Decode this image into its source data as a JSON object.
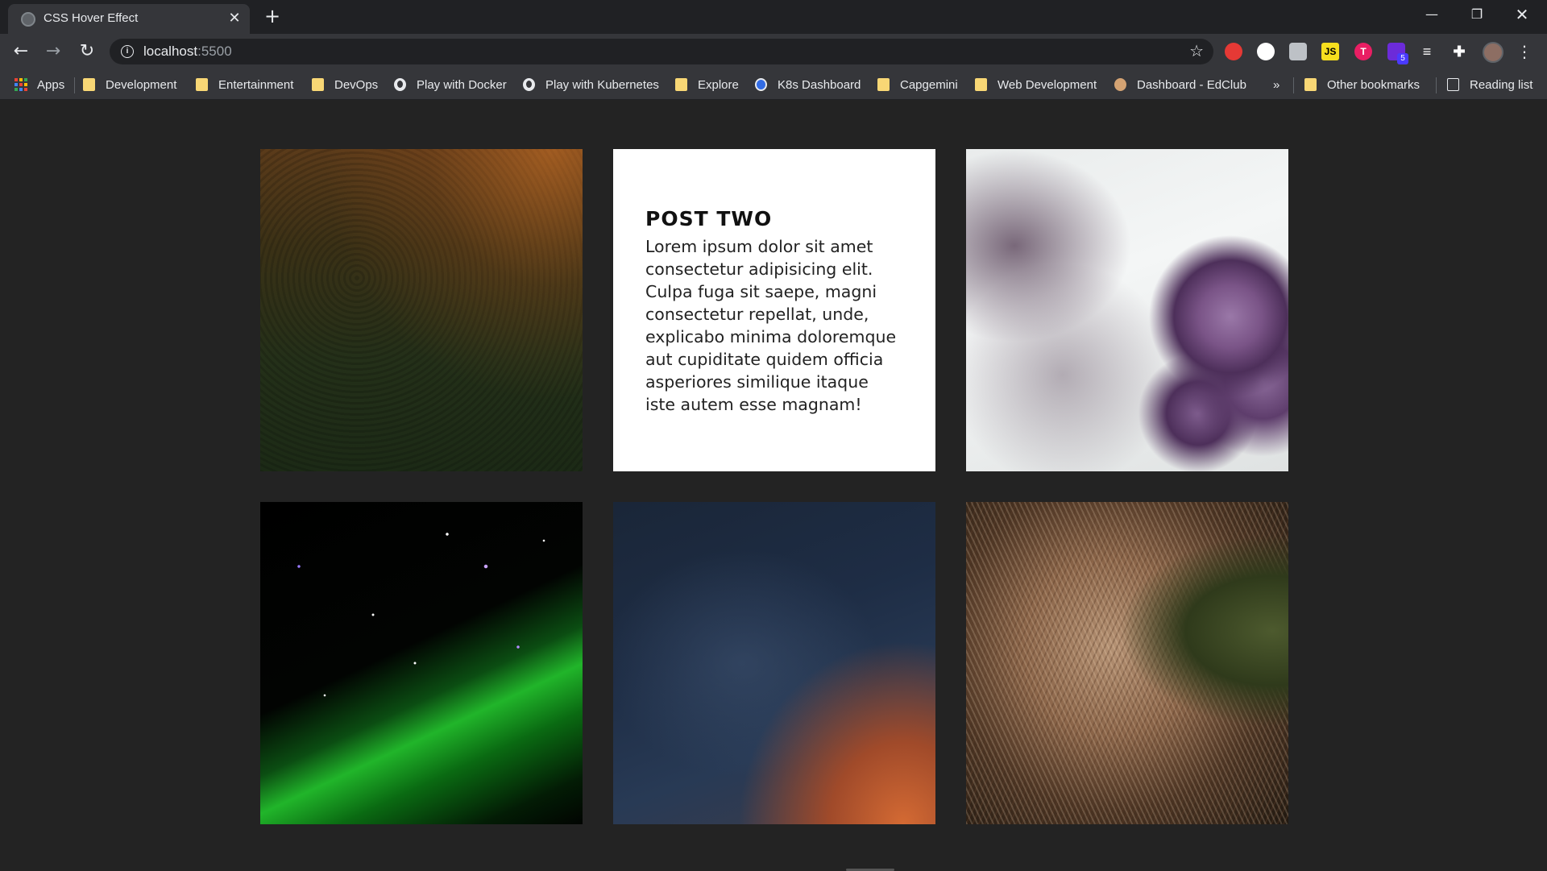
{
  "browser": {
    "tab_title": "CSS Hover Effect",
    "tab_close": "✕",
    "new_tab": "+",
    "window_controls": {
      "minimize": "—",
      "maximize": "❐",
      "close": "✕"
    },
    "nav": {
      "back": "←",
      "forward": "→",
      "reload": "↻"
    },
    "url_host": "localhost",
    "url_port": ":5500",
    "info_icon": "i",
    "star": "☆",
    "extensions": [
      "",
      "",
      "",
      "JS",
      "T",
      "",
      "≡",
      "✚"
    ],
    "extension_badge": "5",
    "menu": "⋮"
  },
  "bookmarks": {
    "apps": "Apps",
    "items": [
      "Development",
      "Entertainment",
      "DevOps",
      "Play with Docker",
      "Play with Kubernetes",
      "Explore",
      "K8s Dashboard",
      "Capgemini",
      "Web Development",
      "Dashboard - EdClub"
    ],
    "overflow": "»",
    "other": "Other bookmarks",
    "reading_list": "Reading list"
  },
  "posts": {
    "card2": {
      "title": "POST TWO",
      "body": "Lorem ipsum dolor sit amet consectetur adipisicing elit. Culpa fuga sit saepe, magni consectetur repellat, unde, explicabo minima doloremque aut cupiditate quidem officia asperiores similique itaque iste autem esse magnam!"
    }
  },
  "colors": {
    "page_bg": "#232323",
    "chrome_dark": "#202124",
    "chrome": "#35363a",
    "bookmark_folder": "#f8d775"
  }
}
